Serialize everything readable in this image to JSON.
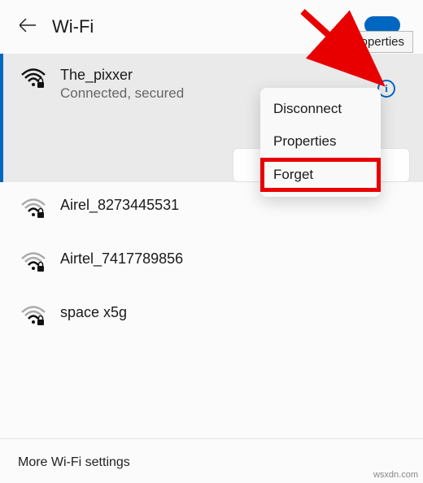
{
  "header": {
    "title": "Wi-Fi"
  },
  "tooltip": {
    "properties": "Properties"
  },
  "networks": {
    "connected": {
      "name": "The_pixxer",
      "status": "Connected, secured"
    },
    "others": [
      {
        "name": "Airel_8273445531"
      },
      {
        "name": "Airtel_7417789856"
      },
      {
        "name": "space x5g"
      }
    ]
  },
  "contextMenu": {
    "disconnect": "Disconnect",
    "properties": "Properties",
    "forget": "Forget"
  },
  "footer": {
    "moreSettings": "More Wi-Fi settings"
  },
  "watermark": "wsxdn.com"
}
